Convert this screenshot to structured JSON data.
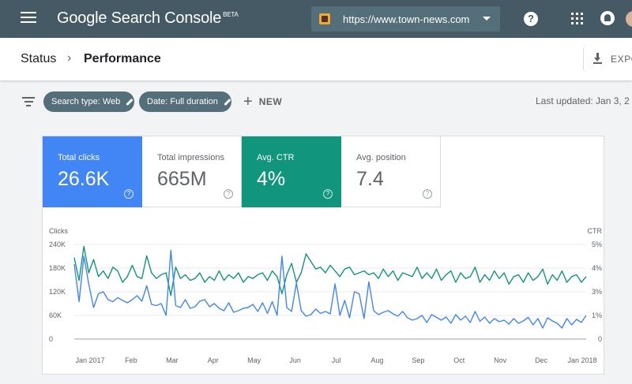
{
  "appbar": {
    "title": "Google Search Console",
    "title_badge": "BETA",
    "property_url": "https://www.town-news.com",
    "help_glyph": "?"
  },
  "breadcrumb": {
    "parent": "Status",
    "separator": "›",
    "current": "Performance",
    "export_label": "EXPO"
  },
  "filters": {
    "search_type": "Search type: Web",
    "date_range": "Date: Full duration",
    "new_label": "NEW",
    "last_updated": "Last updated: Jan 3, 2"
  },
  "metrics": [
    {
      "label": "Total clicks",
      "value": "26.6K",
      "selected": true,
      "color": "#4285f4"
    },
    {
      "label": "Total impressions",
      "value": "665M",
      "selected": false
    },
    {
      "label": "Avg. CTR",
      "value": "4%",
      "selected": true,
      "color": "#12957d"
    },
    {
      "label": "Avg. position",
      "value": "7.4",
      "selected": false
    }
  ],
  "help_glyph": "?",
  "chart_data": {
    "type": "line",
    "left_axis_label": "Clicks",
    "right_axis_label": "CTR",
    "left_ticks": [
      "240K",
      "180K",
      "120K",
      "60K",
      "0"
    ],
    "right_ticks": [
      "5%",
      "4%",
      "3%",
      "1%",
      "0"
    ],
    "ylim_left": [
      0,
      240000
    ],
    "ylim_right": [
      0,
      5
    ],
    "x_tick_labels": [
      "Jan 2017",
      "Feb",
      "Mar",
      "Apr",
      "May",
      "Jun",
      "Jul",
      "Aug",
      "Sep",
      "Oct",
      "Nov",
      "Dec",
      "Jan 2018"
    ],
    "grid": "horizontal",
    "series": [
      {
        "name": "Clicks",
        "axis": "left",
        "color": "#4285f4",
        "values": [
          190000,
          95000,
          210000,
          140000,
          80000,
          115000,
          120000,
          100000,
          95000,
          105000,
          98000,
          92000,
          100000,
          110000,
          96000,
          135000,
          88000,
          85000,
          90000,
          60000,
          225000,
          85000,
          80000,
          100000,
          78000,
          82000,
          96000,
          100000,
          82000,
          90000,
          78000,
          72000,
          92000,
          68000,
          72000,
          78000,
          80000,
          88000,
          70000,
          92000,
          65000,
          95000,
          60000,
          210000,
          80000,
          70000,
          142000,
          72000,
          58000,
          62000,
          76000,
          65000,
          70000,
          64000,
          140000,
          60000,
          98000,
          54000,
          120000,
          115000,
          52000,
          145000,
          72000,
          62000,
          68000,
          72000,
          64000,
          58000,
          70000,
          54000,
          48000,
          52000,
          60000,
          42000,
          62000,
          55000,
          48000,
          56000,
          40000,
          62000,
          48000,
          58000,
          42000,
          70000,
          45000,
          56000,
          40000,
          52000,
          44000,
          48000,
          38000,
          52000,
          40000,
          46000,
          55000,
          36000,
          52000,
          28000,
          54000,
          46000,
          40000,
          28000,
          52000,
          36000,
          50000,
          42000,
          60000
        ]
      },
      {
        "name": "CTR",
        "axis": "right",
        "color": "#12957d",
        "values": [
          4.3,
          3.1,
          4.9,
          3.5,
          4.2,
          3.3,
          3.6,
          3.2,
          3.8,
          3.6,
          3.0,
          3.3,
          3.9,
          3.3,
          3.2,
          4.4,
          3.5,
          3.2,
          3.4,
          3.5,
          2.3,
          3.8,
          3.2,
          3.4,
          3.1,
          3.2,
          3.5,
          3.0,
          3.3,
          3.1,
          3.6,
          3.1,
          3.4,
          3.2,
          3.5,
          3.0,
          3.3,
          3.2,
          3.4,
          3.5,
          3.1,
          3.6,
          3.3,
          2.4,
          3.4,
          4.0,
          3.0,
          3.5,
          4.5,
          4.1,
          3.7,
          3.8,
          3.5,
          3.9,
          3.6,
          3.3,
          3.7,
          3.8,
          3.4,
          3.5,
          3.6,
          3.4,
          3.5,
          3.2,
          3.7,
          3.3,
          3.6,
          3.1,
          3.5,
          3.4,
          3.3,
          3.8,
          3.2,
          3.5,
          3.2,
          3.7,
          3.1,
          3.4,
          3.6,
          3.0,
          3.5,
          3.2,
          3.3,
          3.8,
          3.0,
          3.4,
          3.1,
          3.6,
          3.2,
          3.5,
          2.9,
          3.3,
          3.4,
          3.0,
          3.5,
          3.1,
          3.3,
          3.7,
          2.9,
          3.4,
          3.1,
          3.6,
          3.0,
          3.3,
          3.4,
          3.0,
          3.3
        ]
      }
    ]
  }
}
